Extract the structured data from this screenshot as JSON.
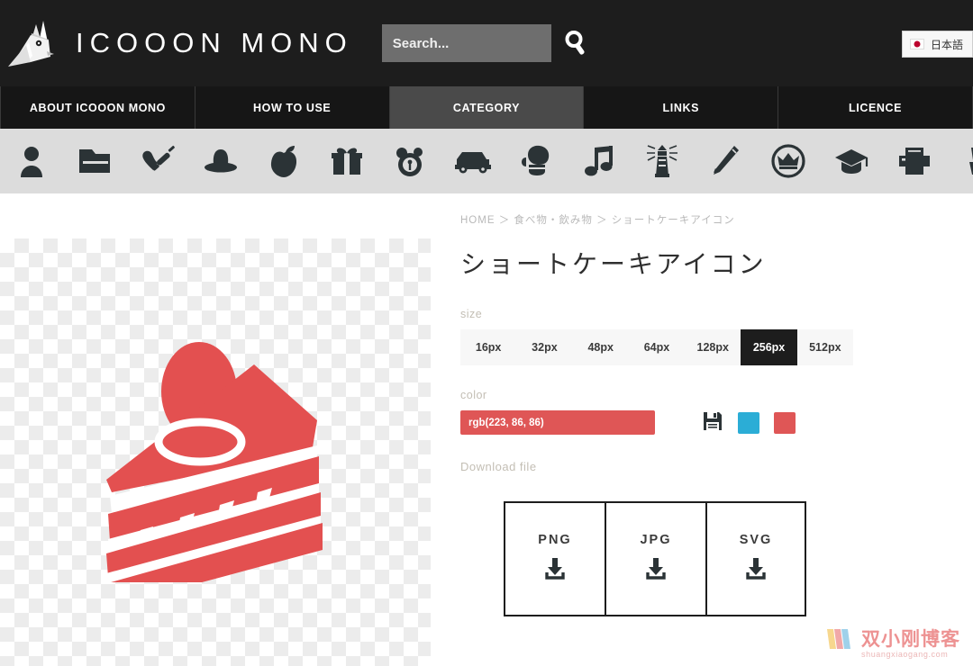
{
  "header": {
    "logo_text": "ICOOON MONO",
    "logo_icon": "unicorn-logo-icon",
    "search_placeholder": "Search...",
    "search_value": "",
    "search_icon": "search-icon",
    "language_label": "日本語",
    "language_flag": "japan-flag-icon"
  },
  "nav": {
    "items": [
      {
        "label": "ABOUT ICOOON MONO",
        "active": false
      },
      {
        "label": "HOW TO USE",
        "active": false
      },
      {
        "label": "CATEGORY",
        "active": true
      },
      {
        "label": "LINKS",
        "active": false
      },
      {
        "label": "LICENCE",
        "active": false
      }
    ]
  },
  "category_icons": [
    {
      "name": "person-icon"
    },
    {
      "name": "folder-icon"
    },
    {
      "name": "heart-syringe-medical-icon"
    },
    {
      "name": "hat-icon"
    },
    {
      "name": "apple-icon"
    },
    {
      "name": "gift-icon"
    },
    {
      "name": "teddy-bear-icon"
    },
    {
      "name": "car-icon"
    },
    {
      "name": "boxing-glove-icon"
    },
    {
      "name": "music-note-icon"
    },
    {
      "name": "lighthouse-icon"
    },
    {
      "name": "pencil-icon"
    },
    {
      "name": "crown-badge-icon"
    },
    {
      "name": "graduation-cap-icon"
    },
    {
      "name": "printer-icon"
    },
    {
      "name": "partial-icon"
    }
  ],
  "preview": {
    "icon_name": "shortcake-icon",
    "icon_color": "#df5656",
    "background": "transparent-checkerboard"
  },
  "main": {
    "breadcrumb": "HOME ＞ 食べ物・飲み物 ＞ ショートケーキアイコン",
    "title": "ショートケーキアイコン",
    "size": {
      "label": "size",
      "options": [
        "16px",
        "32px",
        "48px",
        "64px",
        "128px",
        "256px",
        "512px"
      ],
      "selected": "256px"
    },
    "color": {
      "label": "color",
      "value": "rgb(223, 86, 86)",
      "save_icon": "floppy-save-icon",
      "swatches": [
        {
          "name": "swatch-cyan",
          "hex": "#2BADD6"
        },
        {
          "name": "swatch-red",
          "hex": "#DF5656"
        }
      ]
    },
    "download": {
      "label": "Download file",
      "buttons": [
        {
          "format": "PNG",
          "icon": "download-icon"
        },
        {
          "format": "JPG",
          "icon": "download-icon"
        },
        {
          "format": "SVG",
          "icon": "download-icon"
        }
      ]
    }
  },
  "watermark": {
    "title": "双小刚博客",
    "url": "shuangxiaogang.com"
  },
  "colors": {
    "header_bg": "#1d1d1d",
    "nav_bg": "#161616",
    "nav_active_bg": "#4a4a4a",
    "icon_strip_bg": "#dcdcdc",
    "accent_red": "#df5656",
    "label_gray": "#c3beb4"
  }
}
